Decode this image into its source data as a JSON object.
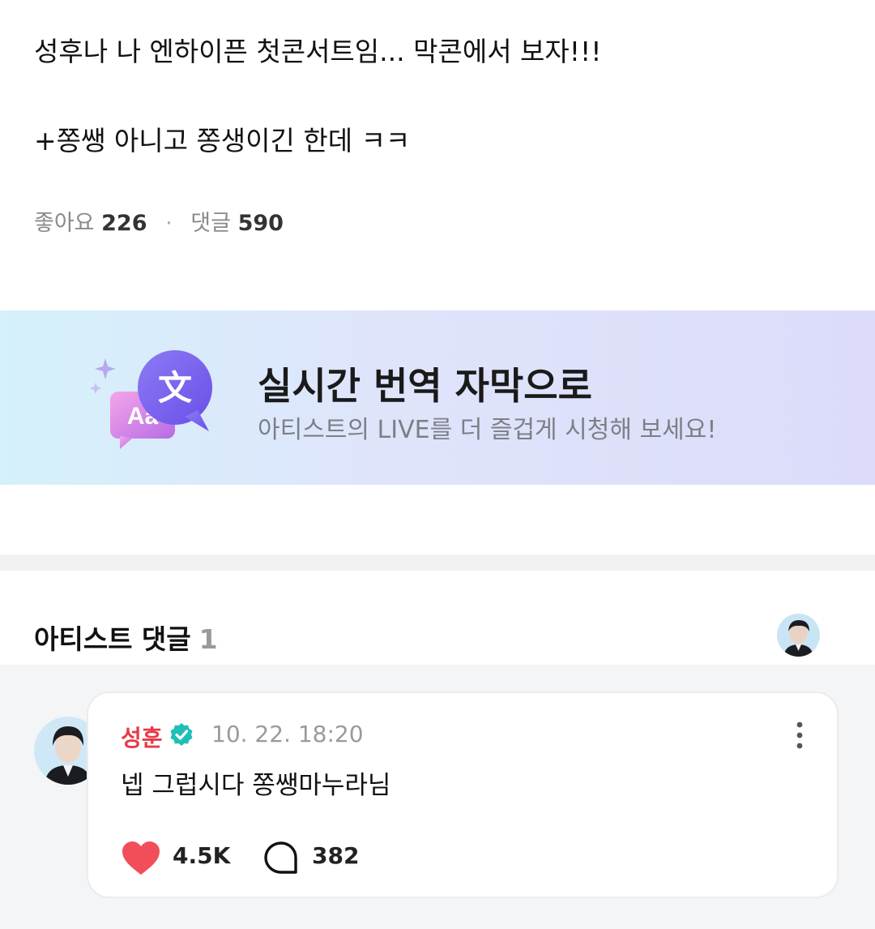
{
  "post": {
    "line1": "성후나 나 엔하이픈 첫콘서트임... 막콘에서 보자!!!",
    "line2": "+쫑쌩 아니고 쫑생이긴 한데 ㅋㅋ",
    "likes_label": "좋아요",
    "likes_count": "226",
    "comments_label": "댓글",
    "comments_count": "590",
    "separator": "·"
  },
  "banner": {
    "title": "실시간 번역 자막으로",
    "subtitle": "아티스트의 LIVE를 더 즐겁게 시청해 보세요!",
    "icon_glyph_main": "文",
    "icon_glyph_sub": "Aa",
    "colors": {
      "gradient_start": "#d5f1fb",
      "gradient_end": "#dcdcfa"
    }
  },
  "artist_comments": {
    "title": "아티스트 댓글",
    "count": "1"
  },
  "comment": {
    "author": "성훈",
    "timestamp": "10. 22. 18:20",
    "text": "넵 그럽시다 쫑쌩마누라님",
    "likes": "4.5K",
    "replies": "382",
    "colors": {
      "author": "#e8394b",
      "verified": "#1fbfb8",
      "heart": "#f24e5a"
    }
  },
  "icons": {
    "verified": "verified-badge-icon",
    "more": "more-vertical-icon",
    "like": "heart-icon",
    "reply": "speech-bubble-icon",
    "translate": "translate-icon"
  }
}
